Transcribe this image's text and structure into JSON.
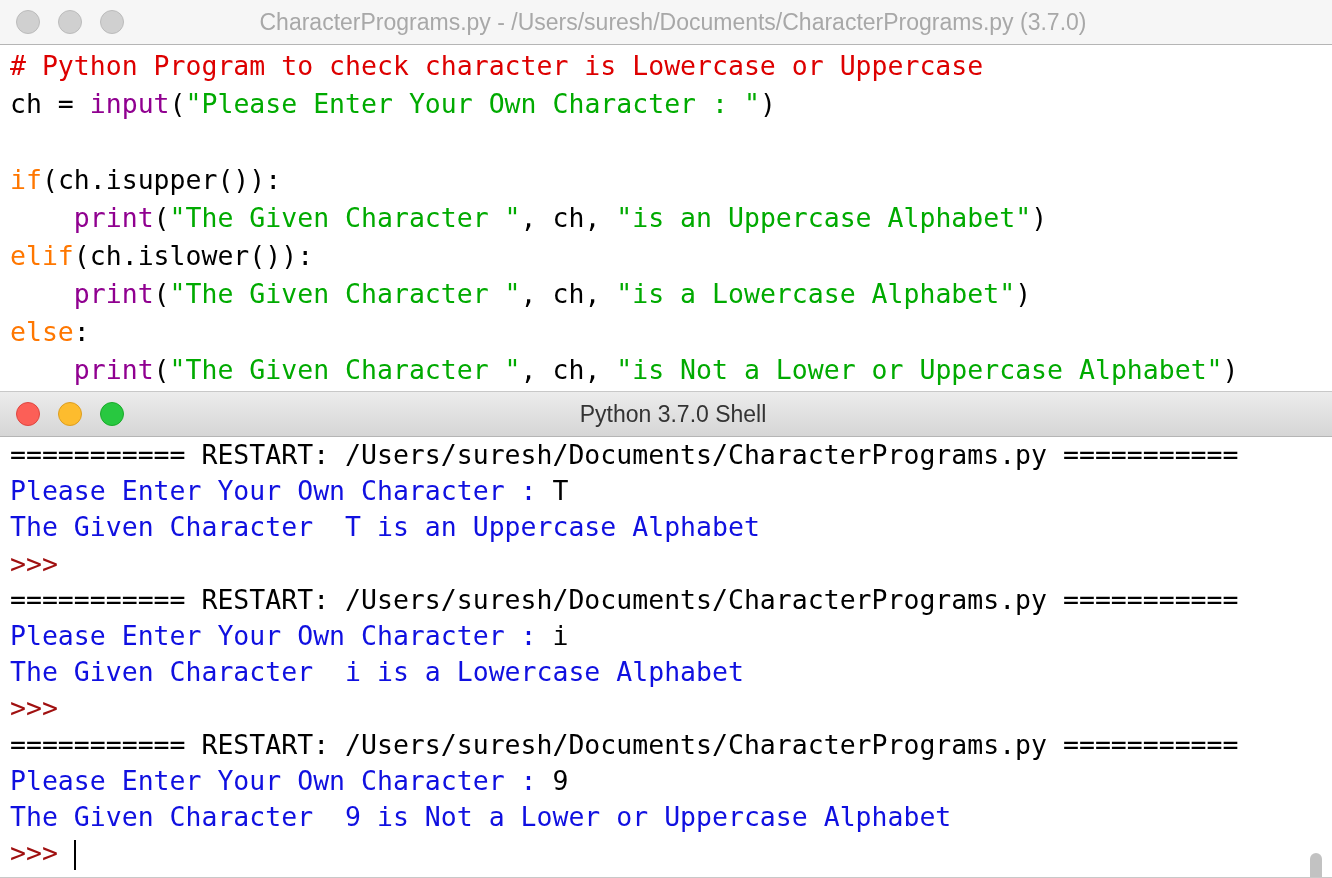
{
  "editor": {
    "title": "CharacterPrograms.py - /Users/suresh/Documents/CharacterPrograms.py (3.7.0)",
    "active": false,
    "lines": [
      {
        "kind": "code",
        "indented": false,
        "tokens": [
          {
            "kind": "comment",
            "text": "# Python Program to check character is Lowercase or Uppercase"
          }
        ]
      },
      {
        "kind": "code",
        "indented": false,
        "tokens": [
          {
            "kind": "plain",
            "text": "ch = "
          },
          {
            "kind": "builtin",
            "text": "input"
          },
          {
            "kind": "plain",
            "text": "("
          },
          {
            "kind": "string",
            "text": "\"Please Enter Your Own Character : \""
          },
          {
            "kind": "plain",
            "text": ")"
          }
        ]
      },
      {
        "kind": "blank"
      },
      {
        "kind": "code",
        "indented": false,
        "tokens": [
          {
            "kind": "keyword",
            "text": "if"
          },
          {
            "kind": "plain",
            "text": "(ch.isupper()):"
          }
        ]
      },
      {
        "kind": "code",
        "indented": true,
        "tokens": [
          {
            "kind": "builtin",
            "text": "print"
          },
          {
            "kind": "plain",
            "text": "("
          },
          {
            "kind": "string",
            "text": "\"The Given Character \""
          },
          {
            "kind": "plain",
            "text": ", ch, "
          },
          {
            "kind": "string",
            "text": "\"is an Uppercase Alphabet\""
          },
          {
            "kind": "plain",
            "text": ")"
          }
        ]
      },
      {
        "kind": "code",
        "indented": false,
        "tokens": [
          {
            "kind": "keyword",
            "text": "elif"
          },
          {
            "kind": "plain",
            "text": "(ch.islower()):"
          }
        ]
      },
      {
        "kind": "code",
        "indented": true,
        "tokens": [
          {
            "kind": "builtin",
            "text": "print"
          },
          {
            "kind": "plain",
            "text": "("
          },
          {
            "kind": "string",
            "text": "\"The Given Character \""
          },
          {
            "kind": "plain",
            "text": ", ch, "
          },
          {
            "kind": "string",
            "text": "\"is a Lowercase Alphabet\""
          },
          {
            "kind": "plain",
            "text": ")"
          }
        ]
      },
      {
        "kind": "code",
        "indented": false,
        "tokens": [
          {
            "kind": "keyword",
            "text": "else"
          },
          {
            "kind": "plain",
            "text": ":"
          }
        ]
      },
      {
        "kind": "code",
        "indented": true,
        "tokens": [
          {
            "kind": "builtin",
            "text": "print"
          },
          {
            "kind": "plain",
            "text": "("
          },
          {
            "kind": "string",
            "text": "\"The Given Character \""
          },
          {
            "kind": "plain",
            "text": ", ch, "
          },
          {
            "kind": "string",
            "text": "\"is Not a Lower or Uppercase Alphabet\""
          },
          {
            "kind": "plain",
            "text": ")"
          }
        ]
      }
    ]
  },
  "shell": {
    "title": "Python 3.7.0 Shell",
    "active": true,
    "lines": [
      {
        "kind": "code",
        "indented": false,
        "tokens": [
          {
            "kind": "restart",
            "text": "=========== RESTART: /Users/suresh/Documents/CharacterPrograms.py ==========="
          }
        ]
      },
      {
        "kind": "code",
        "indented": false,
        "tokens": [
          {
            "kind": "stdout",
            "text": "Please Enter Your Own Character : "
          },
          {
            "kind": "stdin",
            "text": "T"
          }
        ]
      },
      {
        "kind": "code",
        "indented": false,
        "tokens": [
          {
            "kind": "stdout",
            "text": "The Given Character  T is an Uppercase Alphabet"
          }
        ]
      },
      {
        "kind": "code",
        "indented": false,
        "tokens": [
          {
            "kind": "prompt",
            "text": ">>>"
          }
        ]
      },
      {
        "kind": "code",
        "indented": false,
        "tokens": [
          {
            "kind": "restart",
            "text": "=========== RESTART: /Users/suresh/Documents/CharacterPrograms.py ==========="
          }
        ]
      },
      {
        "kind": "code",
        "indented": false,
        "tokens": [
          {
            "kind": "stdout",
            "text": "Please Enter Your Own Character : "
          },
          {
            "kind": "stdin",
            "text": "i"
          }
        ]
      },
      {
        "kind": "code",
        "indented": false,
        "tokens": [
          {
            "kind": "stdout",
            "text": "The Given Character  i is a Lowercase Alphabet"
          }
        ]
      },
      {
        "kind": "code",
        "indented": false,
        "tokens": [
          {
            "kind": "prompt",
            "text": ">>>"
          }
        ]
      },
      {
        "kind": "code",
        "indented": false,
        "tokens": [
          {
            "kind": "restart",
            "text": "=========== RESTART: /Users/suresh/Documents/CharacterPrograms.py ==========="
          }
        ]
      },
      {
        "kind": "code",
        "indented": false,
        "tokens": [
          {
            "kind": "stdout",
            "text": "Please Enter Your Own Character : "
          },
          {
            "kind": "stdin",
            "text": "9"
          }
        ]
      },
      {
        "kind": "code",
        "indented": false,
        "tokens": [
          {
            "kind": "stdout",
            "text": "The Given Character  9 is Not a Lower or Uppercase Alphabet"
          }
        ]
      },
      {
        "kind": "code",
        "indented": false,
        "tokens": [
          {
            "kind": "prompt",
            "text": ">>>"
          }
        ]
      }
    ]
  }
}
